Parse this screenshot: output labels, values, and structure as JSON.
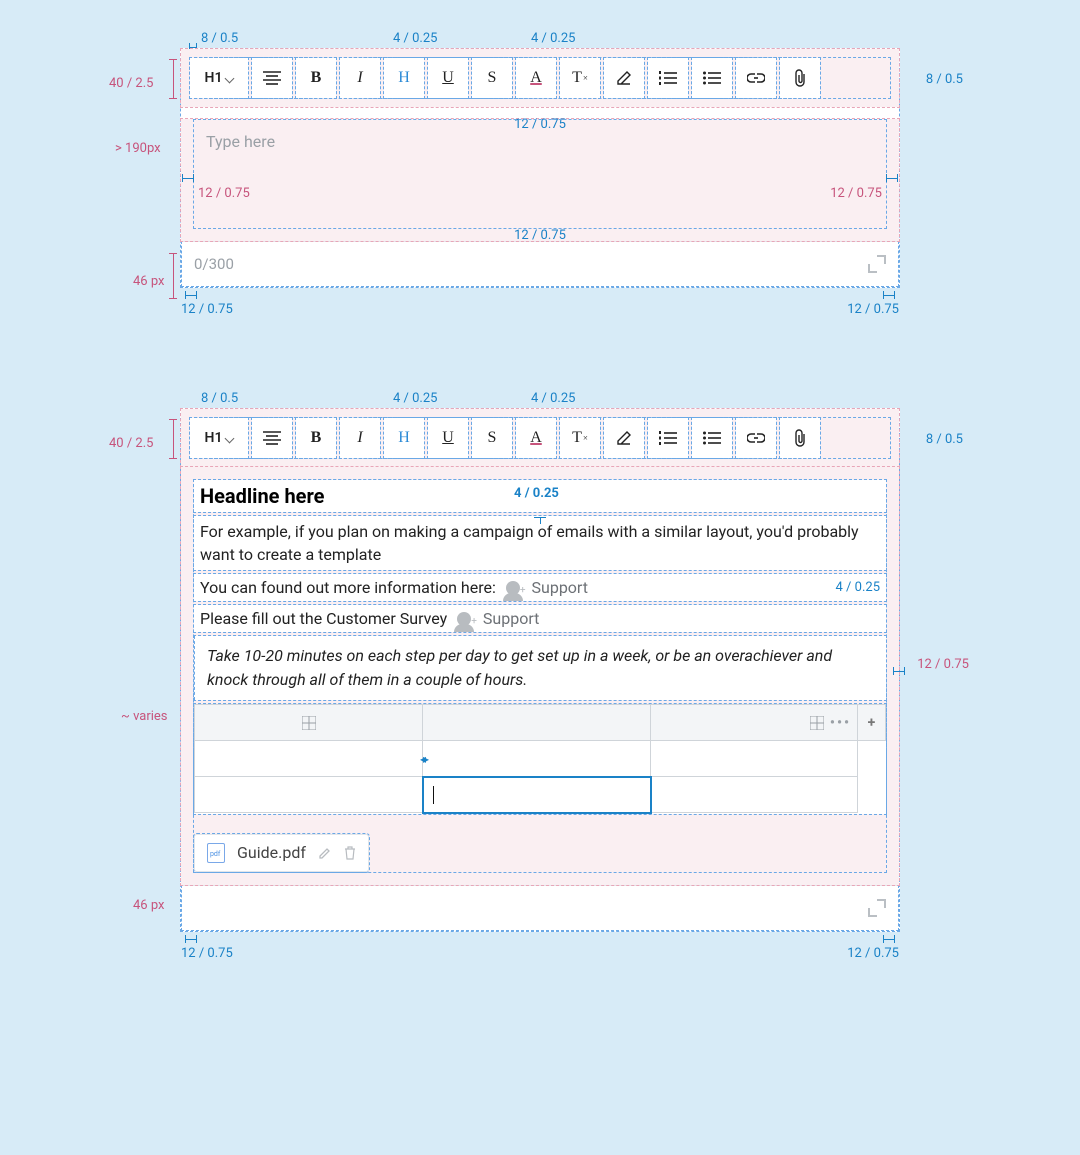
{
  "spec": {
    "toolbarHeight": "40 / 2.5",
    "pad8": "8 / 0.5",
    "gap4": "4 / 0.25",
    "pad12": "12 / 0.75",
    "bodyMin": "> 190px",
    "footerH": "46 px",
    "bodyVaries": "~ varies"
  },
  "toolbar": {
    "heading": "H1",
    "bold": "B",
    "italic": "I",
    "h_char": "H",
    "underline": "U",
    "strike": "S",
    "fontChar": "A",
    "clearChar": "T",
    "clearSub": "×"
  },
  "editorA": {
    "placeholder": "Type here",
    "counter": "0/300"
  },
  "editorB": {
    "headline": "Headline here",
    "paragraph": "For example, if you plan on making a campaign of emails with a similar layout, you'd probably want to create a template",
    "infoLine": "You can found out more information here:",
    "surveyLine": "Please fill out the Customer Survey",
    "supportLabel": "Support",
    "quote": "Take 10-20 minutes on each step per day to get set up in a week, or be an overachiever and knock through all of them in a couple of hours.",
    "attachment": "Guide.pdf"
  }
}
